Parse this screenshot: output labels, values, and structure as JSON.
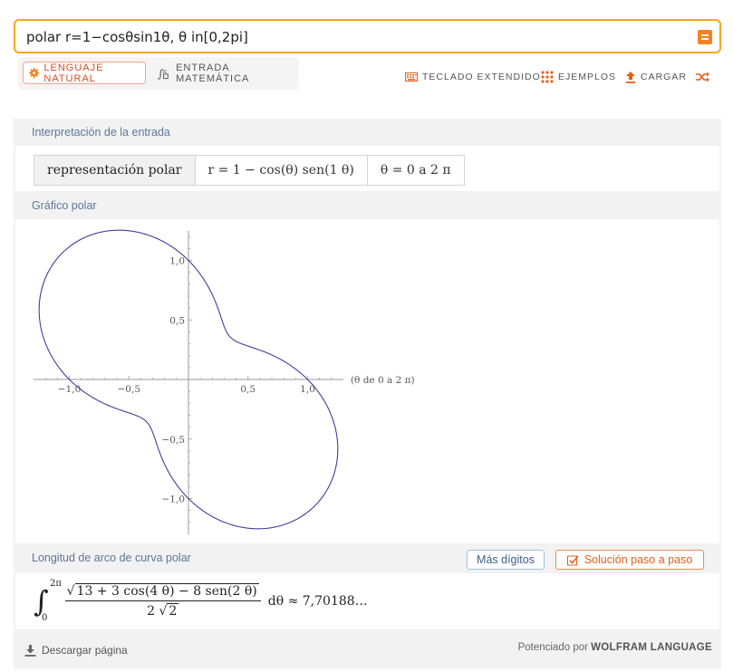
{
  "search": {
    "value": "polar r=1−cosθsin1θ, θ in[0,2pi]"
  },
  "modes": {
    "natural": "LENGUAJE NATURAL",
    "math": "ENTRADA MATEMÁTICA"
  },
  "toolbar": {
    "keyboard": "TECLADO EXTENDIDO",
    "examples": "EJEMPLOS",
    "upload": "CARGAR"
  },
  "pods": {
    "interpretation": {
      "title": "Interpretación de la entrada",
      "cell1": "representación polar",
      "cell2": "r = 1 − cos(θ) sen(1 θ)",
      "cell3": "θ = 0  a  2 π"
    },
    "plot": {
      "title": "Gráfico polar"
    },
    "arclength": {
      "title": "Longitud de arco de curva polar",
      "more_digits": "Más dígitos",
      "step_by_step": "Solución paso a paso",
      "int_upper": "2π",
      "int_lower": "0",
      "numerator": "13 + 3 cos(4 θ) − 8 sen(2 θ)",
      "denominator_prefix": "2",
      "denominator_root": "2",
      "result": "dθ ≈ 7,70188…"
    }
  },
  "footer": {
    "download": "Descargar página",
    "powered_prefix": "Potenciado por",
    "powered_brand": "WOLFRAM LANGUAGE"
  },
  "colors": {
    "accent": "#f58220",
    "curve": "#3f3f9a",
    "title_blue": "#5d7898"
  },
  "chart_data": {
    "type": "line",
    "title": "",
    "equation": "r = 1 - cos(θ) sin(θ)",
    "theta_range": [
      0,
      6.283185
    ],
    "xlim": [
      -1.3,
      1.3
    ],
    "ylim": [
      -1.3,
      1.25
    ],
    "x_ticks": [
      "−1,0",
      "−0,5",
      "0,5",
      "1,0"
    ],
    "y_ticks": [
      "1,0",
      "0,5",
      "−0,5",
      "−1,0"
    ],
    "axis_note": "(θ de 0 a 2 π)",
    "grid": false
  }
}
